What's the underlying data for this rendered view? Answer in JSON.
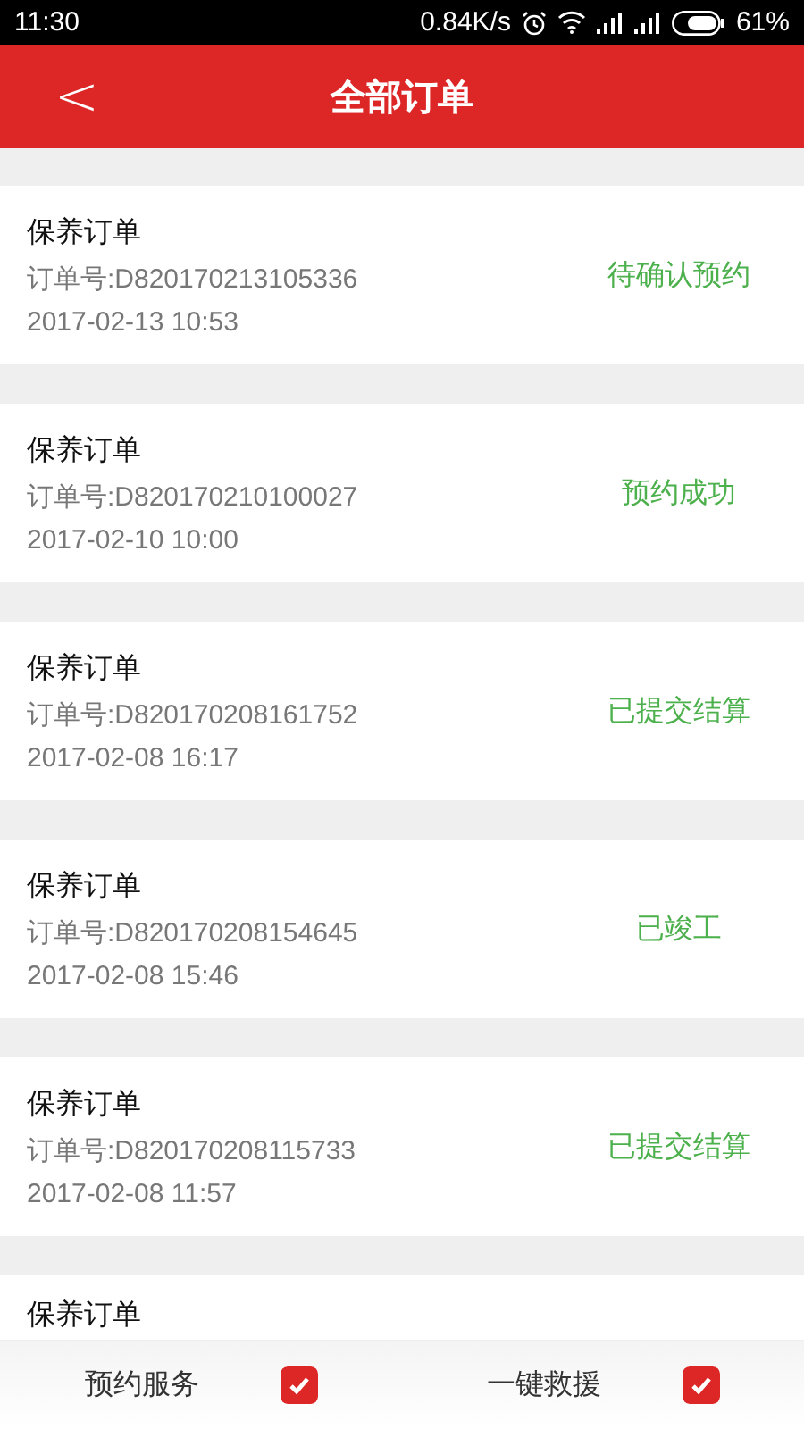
{
  "status_bar": {
    "time": "11:30",
    "speed": "0.84K/s",
    "battery": "61%"
  },
  "header": {
    "back": "<",
    "title": "全部订单"
  },
  "orders": [
    {
      "title": "保养订单",
      "number": "订单号:D820170213105336",
      "date": "2017-02-13 10:53",
      "status": "待确认预约"
    },
    {
      "title": "保养订单",
      "number": "订单号:D820170210100027",
      "date": "2017-02-10 10:00",
      "status": "预约成功"
    },
    {
      "title": "保养订单",
      "number": "订单号:D820170208161752",
      "date": "2017-02-08 16:17",
      "status": "已提交结算"
    },
    {
      "title": "保养订单",
      "number": "订单号:D820170208154645",
      "date": "2017-02-08 15:46",
      "status": "已竣工"
    },
    {
      "title": "保养订单",
      "number": "订单号:D820170208115733",
      "date": "2017-02-08 11:57",
      "status": "已提交结算"
    },
    {
      "title": "保养订单"
    }
  ],
  "bottom_bar": [
    {
      "label": "预约服务",
      "checked": true
    },
    {
      "label": "一键救援",
      "checked": true
    }
  ]
}
